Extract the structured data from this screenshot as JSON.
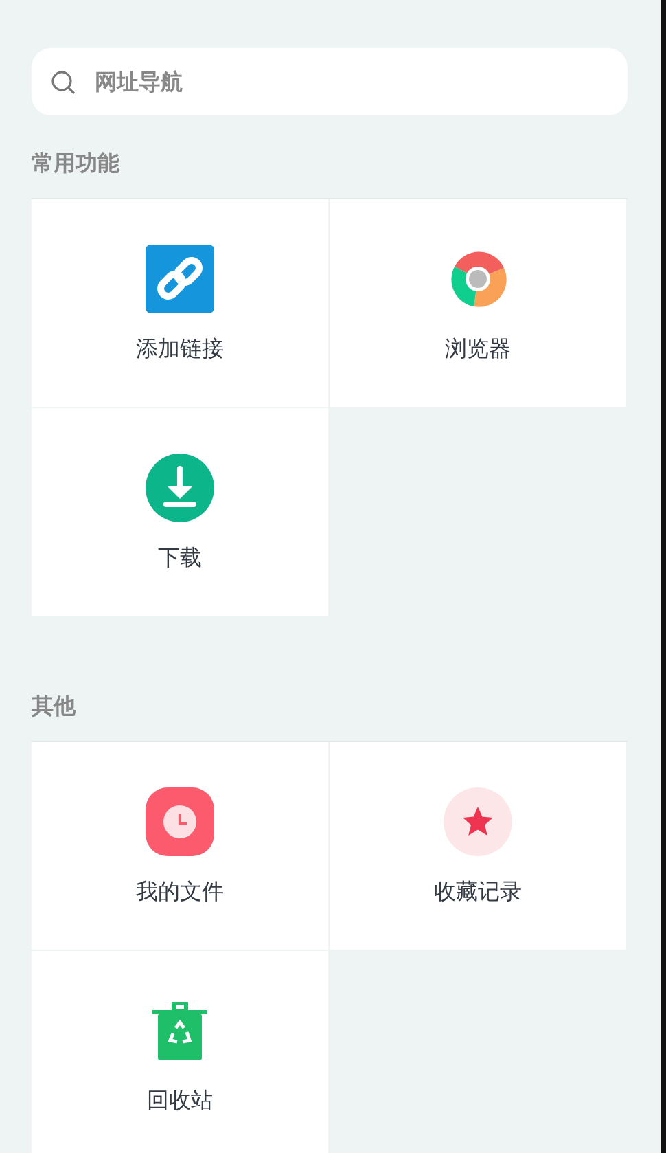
{
  "search": {
    "placeholder": "网址导航"
  },
  "sections": [
    {
      "title": "常用功能",
      "items": [
        {
          "kind": "link",
          "label": "添加链接"
        },
        {
          "kind": "browser",
          "label": "浏览器"
        },
        {
          "kind": "download",
          "label": "下载"
        }
      ]
    },
    {
      "title": "其他",
      "items": [
        {
          "kind": "files",
          "label": "我的文件"
        },
        {
          "kind": "favorites",
          "label": "收藏记录"
        },
        {
          "kind": "recycle",
          "label": "回收站"
        }
      ]
    }
  ]
}
